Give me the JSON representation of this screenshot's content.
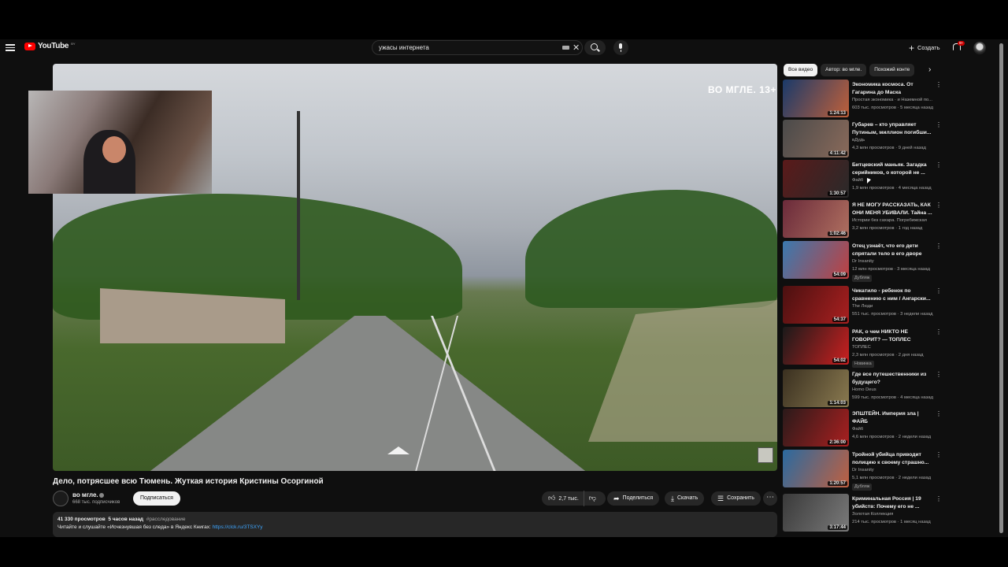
{
  "header": {
    "logo_text": "YouTube",
    "logo_country": "BY",
    "search_value": "ужасы интернета",
    "create_label": "Создать",
    "notifications_badge": "9+"
  },
  "player": {
    "channel_watermark": "ВО МГЛЕ. 13+"
  },
  "video": {
    "title": "Дело, потрясшее всю Тюмень. Жуткая история Кристины Осоргиной",
    "channel": "во мгле.",
    "subscribers": "668 тыс. подписчиков",
    "subscribe_label": "Подписаться",
    "likes": "2,7 тыс.",
    "share_label": "Поделиться",
    "download_label": "Скачать",
    "save_label": "Сохранить",
    "views": "41 330 просмотров",
    "age": "5 часов назад",
    "hashtag": "#расследование",
    "desc_text": "Читайте и слушайте «Исчезнувшая без следа» в Яндекс Книгах:",
    "desc_link": "https://clck.ru/3TSXYy"
  },
  "chips": [
    "Все видео",
    "Автор: во мгле.",
    "Похожий конте"
  ],
  "recommendations": [
    {
      "title": "Экономика космоса. От Гагарина до Маска",
      "channel": "Простая экономика · и Наземной по...",
      "stats": "603 тыс. просмотров · 5 месяца назад",
      "duration": "1:24:13",
      "badge": "",
      "color1": "#1a3a6a",
      "color2": "#c0603a"
    },
    {
      "title": "Губарев – кто управляет Путиным, миллион погибши...",
      "channel": "вДудь",
      "stats": "4,3 млн просмотров · 9 дней назад",
      "duration": "4:11:42",
      "badge": "",
      "color1": "#4a4a4a",
      "color2": "#8a6a5a"
    },
    {
      "title": "Битцевский маньяк. Загадка серийников, о которой не ...",
      "channel": "Файб",
      "stats": "1,9 млн просмотров · 4 месяца назад",
      "duration": "1:30:57",
      "badge": "",
      "color1": "#5a1a1a",
      "color2": "#2a2a2a"
    },
    {
      "title": "Я НЕ МОГУ РАССКАЗАТЬ, КАК ОНИ МЕНЯ УБИВАЛИ. Тайна ...",
      "channel": "Истории без сахара. Погребижская",
      "stats": "3,2 млн просмотров · 1 год назад",
      "duration": "1:02:46",
      "badge": "",
      "color1": "#6a2a3a",
      "color2": "#b07060"
    },
    {
      "title": "Отец узнаёт, что его дети спрятали тело в его дворе",
      "channel": "Dr Insanity",
      "stats": "12 млн просмотров · 3 месяца назад",
      "duration": "54:09",
      "badge": "Дубляж",
      "color1": "#3a7ab0",
      "color2": "#c04040"
    },
    {
      "title": "Чикатило - ребенок по сравнению с ним / Ангарски...",
      "channel": "The Люди",
      "stats": "551 тыс. просмотров · 3 недели назад",
      "duration": "54:37",
      "badge": "",
      "color1": "#4a1010",
      "color2": "#aa2020"
    },
    {
      "title": "РАК, о чем НИКТО НЕ ГОВОРИТ? — ТОПЛЕС",
      "channel": "ТОПЛЕС",
      "stats": "2,3 млн просмотров · 2 дня назад",
      "duration": "54:02",
      "badge": "Новинка",
      "color1": "#1a1a1a",
      "color2": "#cc2020"
    },
    {
      "title": "Где все путешественники из будущего?",
      "channel": "Homo Deus",
      "stats": "599 тыс. просмотров · 4 месяца назад",
      "duration": "1:14:03",
      "badge": "",
      "color1": "#3a3020",
      "color2": "#8a7a50"
    },
    {
      "title": "ЭПШТЕЙН. Империя зла | ФАЙБ",
      "channel": "Файб",
      "stats": "4,6 млн просмотров · 2 недели назад",
      "duration": "2:36:00",
      "badge": "",
      "color1": "#2a1a1a",
      "color2": "#aa2020"
    },
    {
      "title": "Тройной убийца приводит полицию к своему страшно...",
      "channel": "Dr Insanity",
      "stats": "5,1 млн просмотров · 2 недели назад",
      "duration": "1:20:57",
      "badge": "Дубляж",
      "color1": "#2a6aa0",
      "color2": "#c06040"
    },
    {
      "title": "Криминальная Россия | 19 убийств: Почему его не ...",
      "channel": "Золотая Коллекция",
      "stats": "214 тыс. просмотров · 1 месяц назад",
      "duration": "3:17:44",
      "badge": "",
      "color1": "#3a3a3a",
      "color2": "#7a7a7a"
    }
  ]
}
